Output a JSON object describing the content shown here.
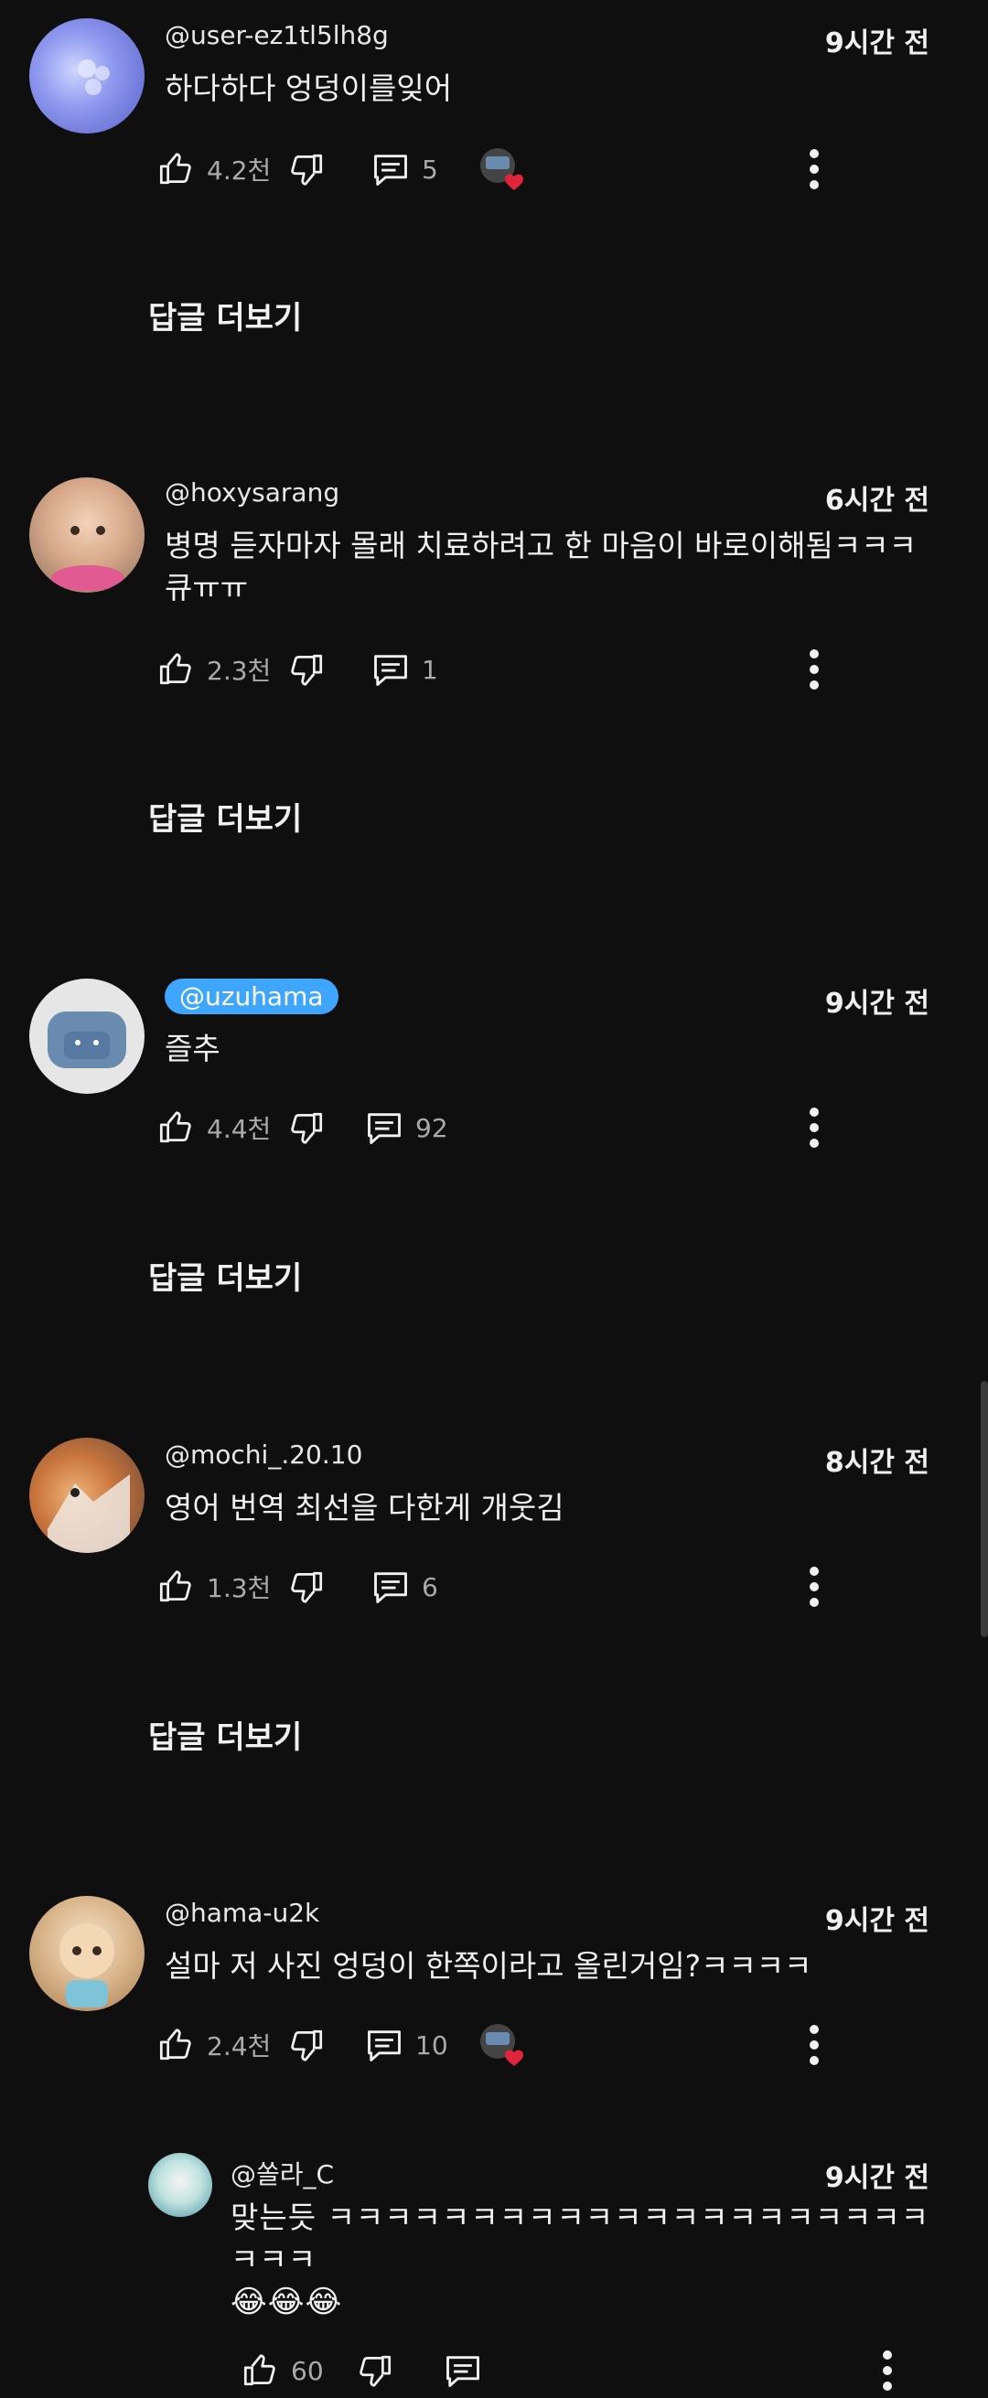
{
  "comments": [
    {
      "handle": "@user-ez1tl5lh8g",
      "time": "9시간 전",
      "text": "하다하다 엉덩이를잊어",
      "likes": "4.2천",
      "replies": "5",
      "reply_link": "답글 더보기"
    },
    {
      "handle": "@hoxysarang",
      "time": "6시간 전",
      "text": "병명 듣자마자 몰래 치료하려고 한 마음이 바로이해됨ㅋㅋㅋ큐ㅠㅠ",
      "likes": "2.3천",
      "replies": "1",
      "reply_link": "답글 더보기"
    },
    {
      "handle": "@uzuhama",
      "time": "9시간 전",
      "text": "즐추",
      "likes": "4.4천",
      "replies": "92",
      "reply_link": "답글 더보기"
    },
    {
      "handle": "@mochi_.20.10",
      "time": "8시간 전",
      "text": "영어 번역 최선을 다한게 개웃김",
      "likes": "1.3천",
      "replies": "6",
      "reply_link": "답글 더보기"
    },
    {
      "handle": "@hama-u2k",
      "time": "9시간 전",
      "text": "설마 저 사진 엉덩이 한쪽이라고 올린거임?ㅋㅋㅋㅋ",
      "likes": "2.4천",
      "replies": "10"
    }
  ],
  "reply": {
    "handle": "@쏠라_C",
    "time": "9시간 전",
    "text": "맞는듯  ㅋㅋㅋㅋㅋㅋㅋㅋㅋㅋㅋㅋㅋㅋㅋㅋㅋㅋㅋㅋㅋㅋㅋㅋ",
    "emoji": "😂😂😂",
    "likes": "60"
  },
  "icons": {
    "like": "thumbs-up-icon",
    "dislike": "thumbs-down-icon",
    "reply": "comment-icon",
    "more": "more-vertical-icon",
    "heart": "creator-heart-icon"
  },
  "colors": {
    "background": "#0f0f0f",
    "text": "#f1f1f1",
    "muted": "#aaaaaa",
    "pill": "#3ea6ff",
    "heart": "#e0243a"
  }
}
